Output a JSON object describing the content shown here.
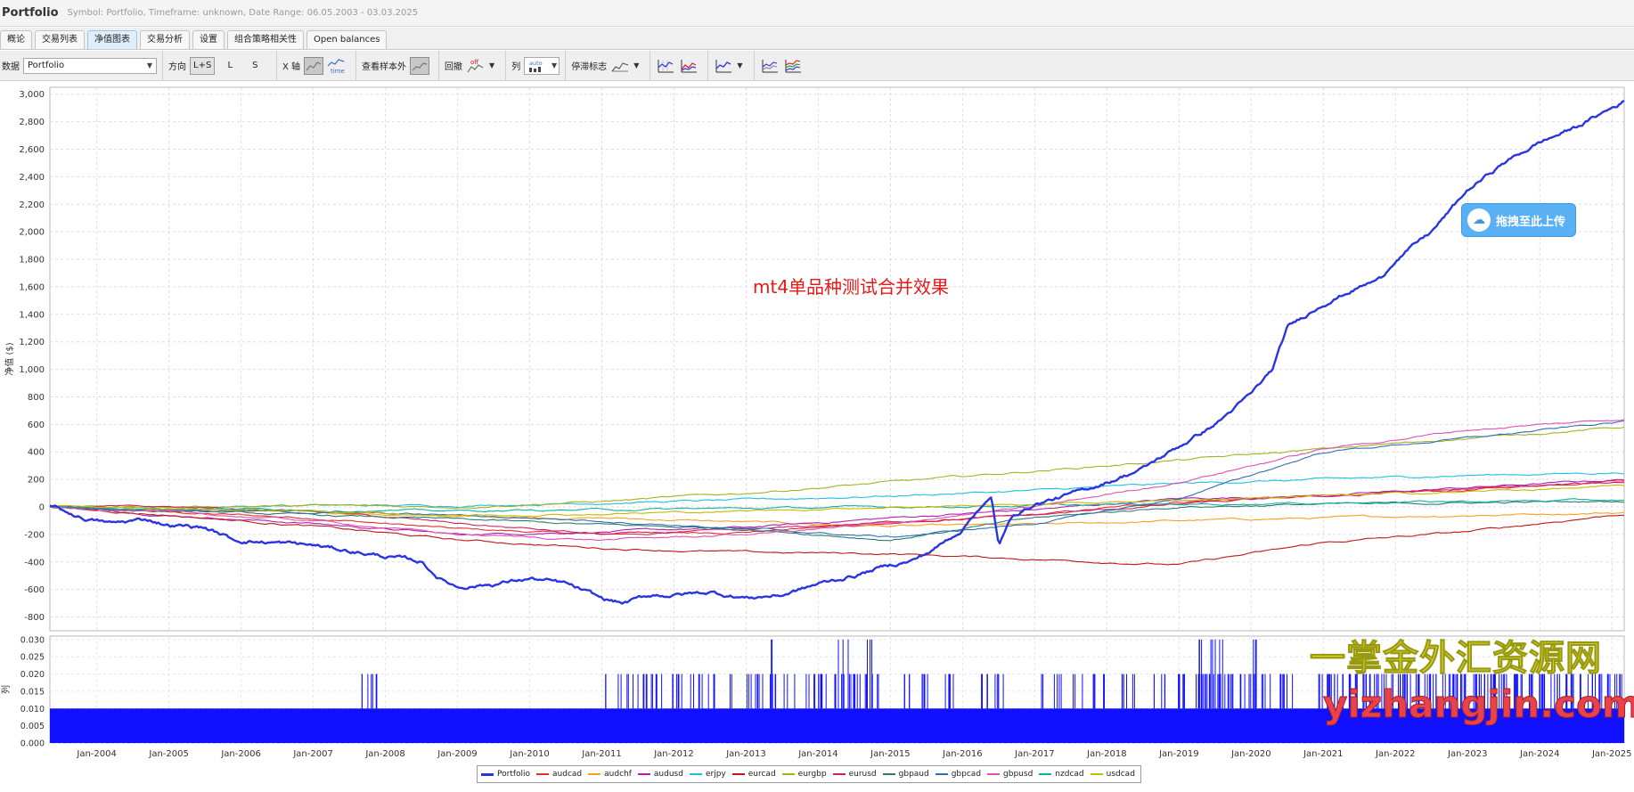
{
  "window": {
    "title": "Portfolio",
    "subtitle": "Symbol: Portfolio, Timeframe: unknown, Date Range: 06.05.2003 - 03.03.2025"
  },
  "tabs": [
    {
      "label": "概论"
    },
    {
      "label": "交易列表"
    },
    {
      "label": "净值图表"
    },
    {
      "label": "交易分析"
    },
    {
      "label": "设置"
    },
    {
      "label": "组合策略相关性"
    },
    {
      "label": "Open balances"
    }
  ],
  "active_tab": "净值图表",
  "toolbar": {
    "data_label": "数据",
    "data_value": "Portfolio",
    "direction_label": "方向",
    "direction_options": [
      "L+S",
      "L",
      "S"
    ],
    "xaxis_label": "X 轴",
    "xaxis_time_label": "time",
    "oos_label": "查看样本外",
    "drawdown_label": "回撤",
    "drawdown_icon_text": "off",
    "column_label": "列",
    "column_icon_text": "auto",
    "stagnation_label": "停滞标志"
  },
  "overlay": {
    "annotation": "mt4单品种测试合并效果",
    "upload_button": "拖拽至此上传",
    "watermark_cn": "一掌金外汇资源网",
    "watermark_en": "yizhangjin.com"
  },
  "chart_data": [
    {
      "type": "line",
      "title": "",
      "ylabel": "净值 ($)",
      "ylim": [
        -900,
        3050
      ],
      "yticks": [
        3000,
        2800,
        2600,
        2400,
        2200,
        2000,
        1800,
        1600,
        1400,
        1200,
        1000,
        800,
        600,
        400,
        200,
        0,
        -200,
        -400,
        -600,
        -800
      ],
      "ytick_labels": [
        "3,000",
        "2,800",
        "2,600",
        "2,400",
        "2,200",
        "2,000",
        "1,800",
        "1,600",
        "1,400",
        "1,200",
        "1,000",
        "800",
        "600",
        "400",
        "200",
        "0",
        "-200",
        "-400",
        "-600",
        "-800"
      ],
      "xlim": [
        2003.35,
        2025.17
      ],
      "xticks": [
        2004,
        2005,
        2006,
        2007,
        2008,
        2009,
        2010,
        2011,
        2012,
        2013,
        2014,
        2015,
        2016,
        2017,
        2018,
        2019,
        2020,
        2021,
        2022,
        2023,
        2024,
        2025
      ],
      "xtick_labels": [
        "Jan-2004",
        "Jan-2005",
        "Jan-2006",
        "Jan-2007",
        "Jan-2008",
        "Jan-2009",
        "Jan-2010",
        "Jan-2011",
        "Jan-2012",
        "Jan-2013",
        "Jan-2014",
        "Jan-2015",
        "Jan-2016",
        "Jan-2017",
        "Jan-2018",
        "Jan-2019",
        "Jan-2020",
        "Jan-2021",
        "Jan-2022",
        "Jan-2023",
        "Jan-2024",
        "Jan-2025"
      ],
      "grid": true,
      "legend_position": "bottom-center",
      "series": [
        {
          "name": "Portfolio",
          "color": "#2a35e0",
          "width": 2.4,
          "x": [
            2003.35,
            2003.8,
            2004.2,
            2004.7,
            2005.0,
            2005.5,
            2005.9,
            2006.5,
            2007.0,
            2007.5,
            2008.0,
            2008.5,
            2008.75,
            2009.0,
            2009.5,
            2010.0,
            2010.5,
            2011.0,
            2011.3,
            2011.7,
            2012.0,
            2012.5,
            2013.0,
            2013.5,
            2014.0,
            2014.5,
            2015.0,
            2015.3,
            2015.6,
            2016.0,
            2016.2,
            2016.4,
            2016.5,
            2016.7,
            2017.0,
            2017.5,
            2018.0,
            2018.5,
            2019.0,
            2019.5,
            2020.0,
            2020.3,
            2020.5,
            2021.0,
            2021.5,
            2021.8,
            2022.0,
            2022.5,
            2023.0,
            2023.5,
            2024.0,
            2024.5,
            2025.0,
            2025.17
          ],
          "y": [
            10,
            -80,
            -120,
            -90,
            -130,
            -150,
            -240,
            -260,
            -280,
            -320,
            -360,
            -400,
            -520,
            -580,
            -560,
            -520,
            -560,
            -670,
            -700,
            -640,
            -640,
            -620,
            -660,
            -640,
            -560,
            -500,
            -420,
            -390,
            -310,
            -160,
            -20,
            60,
            -280,
            -60,
            20,
            90,
            180,
            280,
            440,
            600,
            820,
            1000,
            1300,
            1480,
            1600,
            1660,
            1800,
            2000,
            2300,
            2500,
            2650,
            2760,
            2900,
            2950
          ]
        },
        {
          "name": "audcad",
          "color": "#e03030",
          "width": 1.1,
          "x": [
            2003.35,
            2005,
            2007,
            2009,
            2011,
            2013,
            2015,
            2017,
            2019,
            2021,
            2023,
            2025.17
          ],
          "y": [
            10,
            -40,
            -80,
            -160,
            -200,
            -180,
            -120,
            -60,
            40,
            80,
            120,
            200
          ]
        },
        {
          "name": "audchf",
          "color": "#f5a020",
          "width": 1.1,
          "x": [
            2003.35,
            2005,
            2007,
            2009,
            2011,
            2013,
            2015,
            2017,
            2019,
            2021,
            2023,
            2025.17
          ],
          "y": [
            0,
            -20,
            -40,
            -70,
            -80,
            -110,
            -140,
            -130,
            -100,
            -80,
            -60,
            -40
          ]
        },
        {
          "name": "audusd",
          "color": "#b020b0",
          "width": 1.1,
          "x": [
            2003.35,
            2005,
            2007,
            2009,
            2011,
            2013,
            2015,
            2017,
            2019,
            2021,
            2023,
            2025.17
          ],
          "y": [
            10,
            -60,
            -120,
            -200,
            -180,
            -150,
            -80,
            -20,
            60,
            80,
            140,
            200
          ]
        },
        {
          "name": "erjpy",
          "color": "#20c0e0",
          "width": 1.1,
          "x": [
            2003.35,
            2005,
            2007,
            2009,
            2011,
            2013,
            2015,
            2017,
            2019,
            2021,
            2023,
            2025.17
          ],
          "y": [
            0,
            0,
            10,
            10,
            30,
            50,
            80,
            120,
            170,
            200,
            230,
            250
          ]
        },
        {
          "name": "eurcad",
          "color": "#c01818",
          "width": 1.1,
          "x": [
            2003.35,
            2005,
            2007,
            2009,
            2011,
            2013,
            2015,
            2017,
            2019,
            2021,
            2023,
            2025.17
          ],
          "y": [
            0,
            -60,
            -140,
            -240,
            -300,
            -330,
            -340,
            -380,
            -420,
            -260,
            -180,
            -50
          ]
        },
        {
          "name": "eurgbp",
          "color": "#a8b020",
          "width": 1.1,
          "x": [
            2003.35,
            2005,
            2007,
            2009,
            2011,
            2013,
            2015,
            2017,
            2019,
            2021,
            2023,
            2025.17
          ],
          "y": [
            0,
            0,
            10,
            0,
            40,
            100,
            180,
            260,
            340,
            420,
            500,
            580
          ]
        },
        {
          "name": "eurusd",
          "color": "#d02060",
          "width": 1.1,
          "x": [
            2003.35,
            2005,
            2007,
            2009,
            2011,
            2013,
            2015,
            2017,
            2019,
            2021,
            2023,
            2025.17
          ],
          "y": [
            0,
            0,
            -30,
            -120,
            -200,
            -170,
            -110,
            -60,
            20,
            80,
            130,
            180
          ]
        },
        {
          "name": "gbpaud",
          "color": "#2e7a70",
          "width": 1.1,
          "x": [
            2003.35,
            2005,
            2007,
            2009,
            2011,
            2013,
            2015,
            2017,
            2019,
            2021,
            2023,
            2025.17
          ],
          "y": [
            0,
            -30,
            -60,
            -90,
            -130,
            -160,
            -240,
            -80,
            0,
            20,
            30,
            40
          ]
        },
        {
          "name": "gbpcad",
          "color": "#3070b0",
          "width": 1.1,
          "x": [
            2003.35,
            2005,
            2007,
            2009,
            2011,
            2013,
            2015,
            2017,
            2019,
            2021,
            2023,
            2025.17
          ],
          "y": [
            0,
            -20,
            -40,
            -60,
            -100,
            -160,
            -220,
            -120,
            60,
            400,
            500,
            620
          ]
        },
        {
          "name": "gbpusd",
          "color": "#e050b0",
          "width": 1.1,
          "x": [
            2003.35,
            2005,
            2007,
            2009,
            2011,
            2013,
            2015,
            2017,
            2019,
            2021,
            2023,
            2025.17
          ],
          "y": [
            0,
            -40,
            -100,
            -200,
            -240,
            -200,
            -120,
            0,
            180,
            420,
            560,
            640
          ]
        },
        {
          "name": "nzdcad",
          "color": "#10b0a0",
          "width": 1.1,
          "x": [
            2003.35,
            2005,
            2007,
            2009,
            2011,
            2013,
            2015,
            2017,
            2019,
            2021,
            2023,
            2025.17
          ],
          "y": [
            0,
            -10,
            -20,
            -30,
            -20,
            -10,
            0,
            10,
            20,
            30,
            40,
            50
          ]
        },
        {
          "name": "usdcad",
          "color": "#c8b800",
          "width": 1.1,
          "x": [
            2003.35,
            2005,
            2007,
            2009,
            2011,
            2013,
            2015,
            2017,
            2019,
            2021,
            2023,
            2025.17
          ],
          "y": [
            0,
            -10,
            -30,
            -60,
            -50,
            -30,
            0,
            20,
            50,
            80,
            110,
            150
          ]
        }
      ]
    },
    {
      "type": "bar",
      "title": "",
      "ylabel": "列",
      "ylim": [
        0,
        0.031
      ],
      "yticks": [
        0.0,
        0.005,
        0.01,
        0.015,
        0.02,
        0.025,
        0.03
      ],
      "ytick_labels": [
        "0.000",
        "0.005",
        "0.010",
        "0.015",
        "0.020",
        "0.025",
        "0.030"
      ],
      "color": "#1010ff",
      "baseline_value": 0.01,
      "bars_020": [
        2007.7,
        2007.82,
        2007.88,
        2011.05,
        2011.3,
        2011.5,
        2011.65,
        2011.8,
        2012.0,
        2012.1,
        2012.3,
        2012.45,
        2012.6,
        2012.8,
        2013.0,
        2013.2,
        2013.4,
        2013.6,
        2013.8,
        2014.0,
        2014.1,
        2014.3,
        2014.4,
        2014.5,
        2014.6,
        2014.7,
        2014.8,
        2015.2,
        2015.5,
        2015.8,
        2016.3,
        2016.5,
        2017.1,
        2017.3,
        2017.6,
        2017.8,
        2018.0,
        2018.2,
        2018.4,
        2018.6,
        2018.8,
        2019.0,
        2019.1,
        2019.3,
        2019.4,
        2019.5,
        2019.6,
        2019.7,
        2019.8,
        2019.9,
        2020.0,
        2020.2,
        2020.4,
        2020.5,
        2021.0,
        2021.1,
        2021.2,
        2021.3,
        2021.4,
        2021.5,
        2021.6,
        2021.7,
        2021.8,
        2021.9,
        2022.0,
        2022.1,
        2022.2,
        2022.3,
        2022.4,
        2022.5,
        2022.6,
        2022.7,
        2022.8,
        2022.9,
        2023.0,
        2023.1,
        2023.2,
        2023.3,
        2023.4,
        2023.5,
        2023.6,
        2023.7,
        2023.8,
        2023.9,
        2024.0,
        2024.1,
        2024.2,
        2024.3,
        2024.4,
        2024.5,
        2024.6,
        2024.7,
        2024.8,
        2024.9,
        2025.0,
        2025.1
      ],
      "bars_030": [
        2013.3,
        2014.35,
        2014.75,
        2019.35,
        2019.45,
        2019.55,
        2020.1
      ]
    }
  ],
  "legend": [
    {
      "name": "Portfolio",
      "color": "#2a35e0"
    },
    {
      "name": "audcad",
      "color": "#e03030"
    },
    {
      "name": "audchf",
      "color": "#f5a020"
    },
    {
      "name": "audusd",
      "color": "#b020b0"
    },
    {
      "name": "erjpy",
      "color": "#20c0e0"
    },
    {
      "name": "eurcad",
      "color": "#c01818"
    },
    {
      "name": "eurgbp",
      "color": "#a8b020"
    },
    {
      "name": "eurusd",
      "color": "#d02060"
    },
    {
      "name": "gbpaud",
      "color": "#2e7a70"
    },
    {
      "name": "gbpcad",
      "color": "#3070b0"
    },
    {
      "name": "gbpusd",
      "color": "#e050b0"
    },
    {
      "name": "nzdcad",
      "color": "#10b0a0"
    },
    {
      "name": "usdcad",
      "color": "#c8b800"
    }
  ]
}
